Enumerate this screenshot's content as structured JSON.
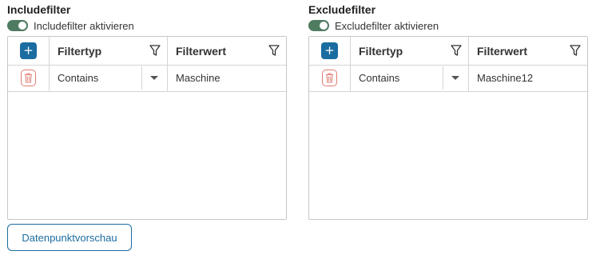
{
  "include": {
    "title": "Includefilter",
    "toggle_label": "Includefilter aktivieren",
    "toggle_on": true,
    "columns": {
      "type": "Filtertyp",
      "value": "Filterwert"
    },
    "add_label": "+",
    "rows": [
      {
        "type": "Contains",
        "value": "Maschine"
      }
    ]
  },
  "exclude": {
    "title": "Excludefilter",
    "toggle_label": "Excludefilter aktivieren",
    "toggle_on": true,
    "columns": {
      "type": "Filtertyp",
      "value": "Filterwert"
    },
    "add_label": "+",
    "rows": [
      {
        "type": "Contains",
        "value": "Maschine12"
      }
    ]
  },
  "preview_button": "Datenpunktvorschau",
  "colors": {
    "accent": "#1b6ca0",
    "toggle_on": "#4f7b61",
    "delete": "#e07b72"
  },
  "icons": {
    "add": "plus-icon",
    "delete": "trash-icon",
    "filter": "funnel-icon",
    "dropdown": "caret-down-icon"
  }
}
